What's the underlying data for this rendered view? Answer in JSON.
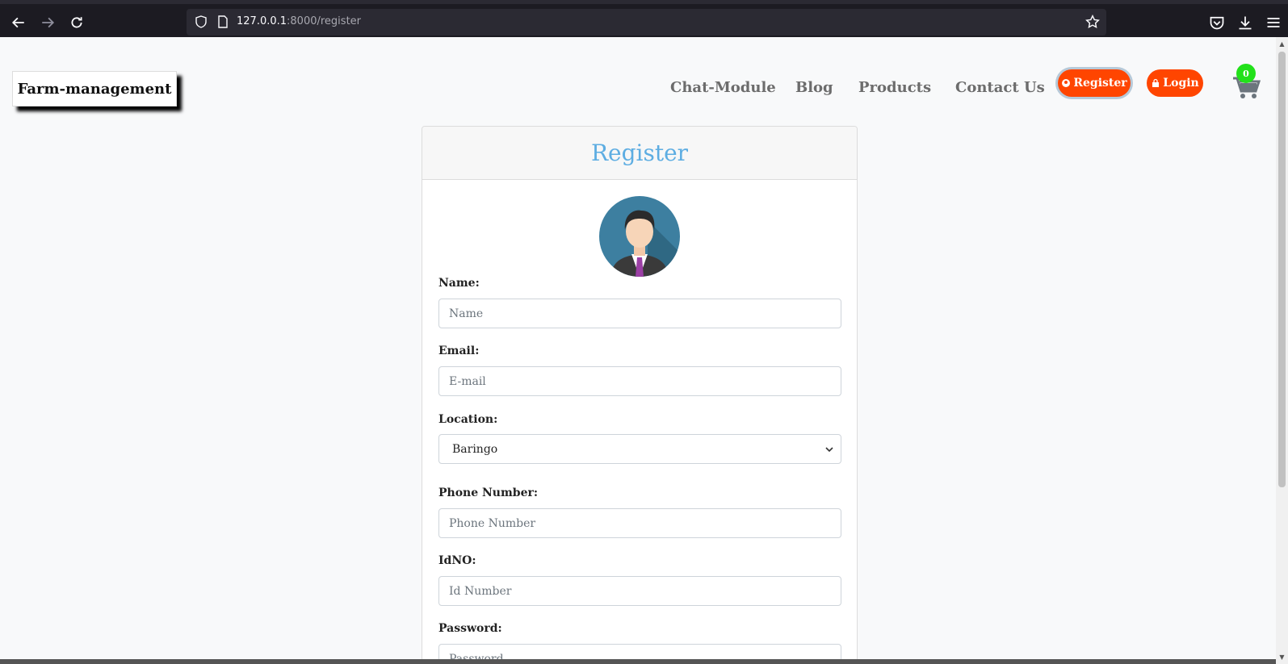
{
  "browser": {
    "url_host": "127.0.0.1",
    "url_path": ":8000/register"
  },
  "navbar": {
    "brand": "Farm-management",
    "links": [
      "Chat-Module",
      "Blog",
      "Products",
      "Contact Us"
    ],
    "register_label": "Register",
    "login_label": "Login",
    "cart_count": "0",
    "accent_color": "#ff4500"
  },
  "form": {
    "title": "Register",
    "name": {
      "label": "Name:",
      "placeholder": "Name"
    },
    "email": {
      "label": "Email:",
      "placeholder": "E-mail"
    },
    "location": {
      "label": "Location:",
      "value": "Baringo"
    },
    "phone": {
      "label": "Phone Number:",
      "placeholder": "Phone Number"
    },
    "idno": {
      "label": "IdNO:",
      "placeholder": "Id Number"
    },
    "password": {
      "label": "Password:",
      "placeholder": "Password"
    }
  }
}
